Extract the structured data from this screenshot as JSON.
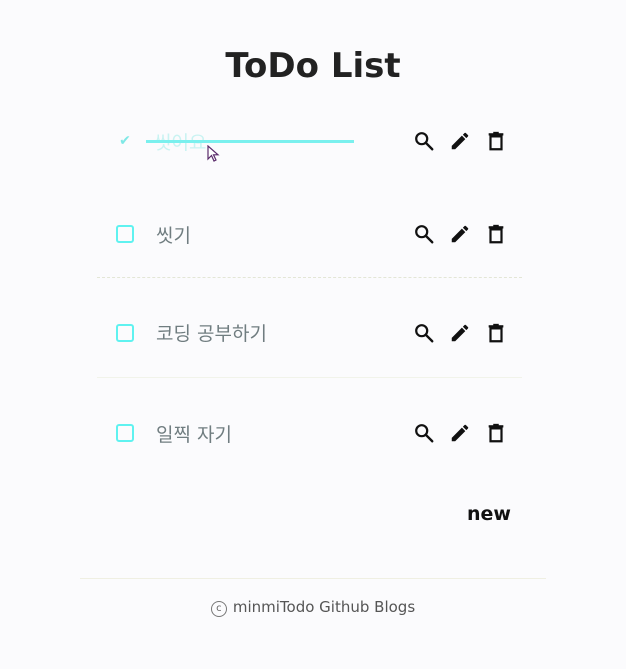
{
  "app": {
    "title": "ToDo List"
  },
  "todos": [
    {
      "label": "씻어요",
      "done": true
    },
    {
      "label": "씻기",
      "done": false
    },
    {
      "label": "코딩 공부하기",
      "done": false
    },
    {
      "label": "일찍 자기",
      "done": false
    }
  ],
  "actions": {
    "search_icon": "search-icon",
    "edit_icon": "pencil-icon",
    "delete_icon": "trash-icon"
  },
  "new_button": {
    "label": "new"
  },
  "footer": {
    "text": "minmiTodo Github Blogs",
    "copyright_symbol": "c"
  },
  "colors": {
    "accent": "#5ff2f0",
    "text": "#707d80"
  }
}
